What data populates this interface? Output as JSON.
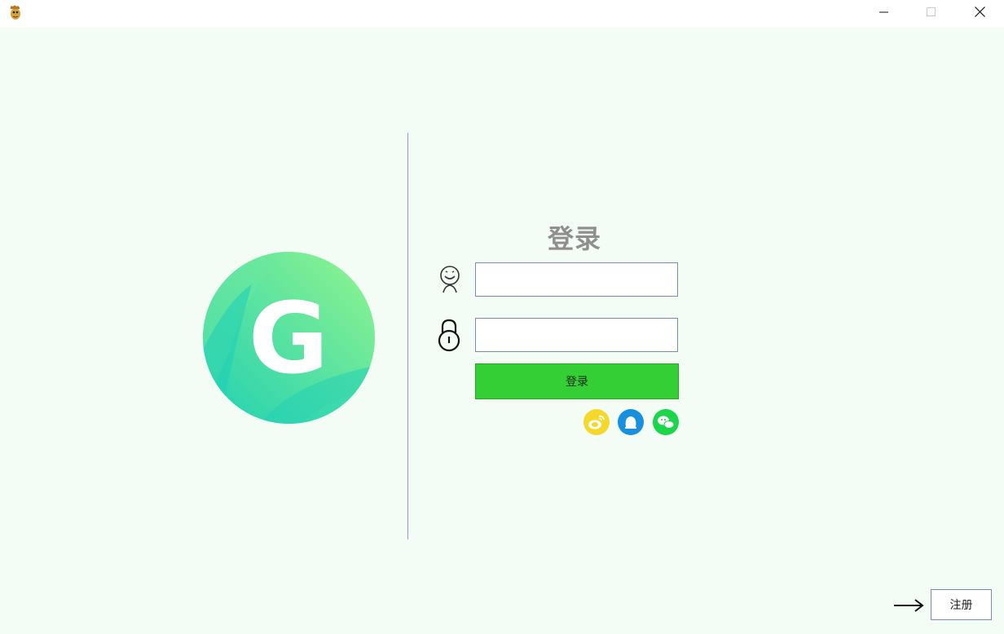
{
  "window": {
    "app_icon": "squirrel-app-icon",
    "controls": [
      "minimize-icon",
      "maximize-icon",
      "close-icon"
    ]
  },
  "logo": {
    "letter": "G",
    "colors": [
      "#1fd0b4",
      "#94f58e"
    ]
  },
  "login": {
    "title": "登录",
    "username": {
      "icon": "user-icon",
      "value": "",
      "placeholder": ""
    },
    "password": {
      "icon": "lock-icon",
      "value": "",
      "placeholder": ""
    },
    "submit_label": "登录",
    "submit_color": "#34cf34",
    "social": [
      {
        "name": "weibo-icon",
        "color": "#f5d82a"
      },
      {
        "name": "qq-icon",
        "color": "#1890e0"
      },
      {
        "name": "wechat-icon",
        "color": "#1ad64a"
      }
    ]
  },
  "footer": {
    "arrow_icon": "arrow-right-icon",
    "register_label": "注册"
  },
  "colors": {
    "background": "#f3fdf6",
    "divider": "#8d9ed0"
  }
}
